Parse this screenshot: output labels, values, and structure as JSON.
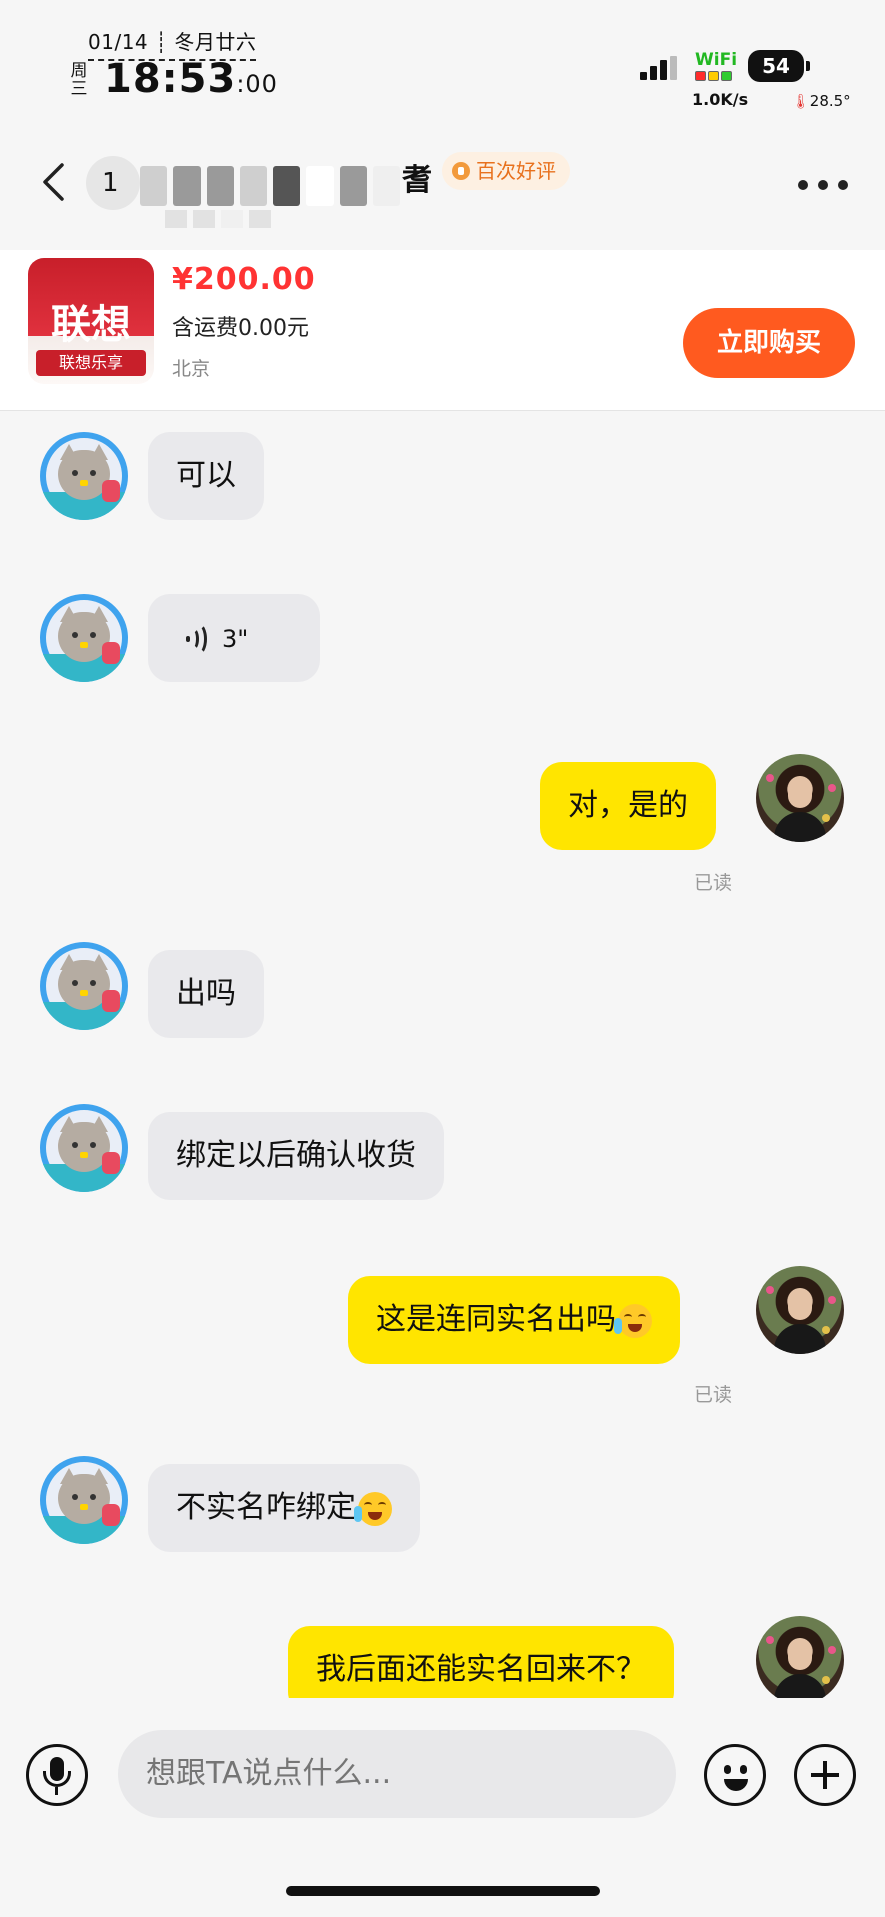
{
  "status_bar": {
    "date": "01/14",
    "lunar": "冬月廿六",
    "weekday": "周三",
    "time": "18:53",
    "seconds": ":00",
    "wifi_label": "WiFi",
    "net_speed": "1.0K/s",
    "battery": "54",
    "temperature": "28.5°"
  },
  "header": {
    "count_badge": "1",
    "name_tail": "耆",
    "review_badge": "百次好评"
  },
  "product": {
    "thumb_logo": "联想",
    "thumb_sub": "联想乐享",
    "price": "¥200.00",
    "shipping": "含运费0.00元",
    "location": "北京",
    "buy_label": "立即购买"
  },
  "messages": [
    {
      "side": "in",
      "text": "可以"
    },
    {
      "side": "in",
      "type": "voice",
      "text": "3\""
    },
    {
      "side": "out",
      "text": "对，是的",
      "read": "已读"
    },
    {
      "side": "in",
      "text": "出吗"
    },
    {
      "side": "in",
      "text": "绑定以后确认收货"
    },
    {
      "side": "out",
      "text": "这是连同实名出吗",
      "emoji": "crying-laughing",
      "read": "已读"
    },
    {
      "side": "in",
      "text": "不实名咋绑定",
      "emoji": "crying-laughing"
    },
    {
      "side": "out",
      "text": "我后面还能实名回来不？"
    }
  ],
  "input": {
    "placeholder": "想跟TA说点什么..."
  },
  "colors": {
    "accent": "#ff5a1f",
    "price": "#ff3333",
    "my_bubble": "#ffe500",
    "their_bubble": "#e9e9ec"
  }
}
